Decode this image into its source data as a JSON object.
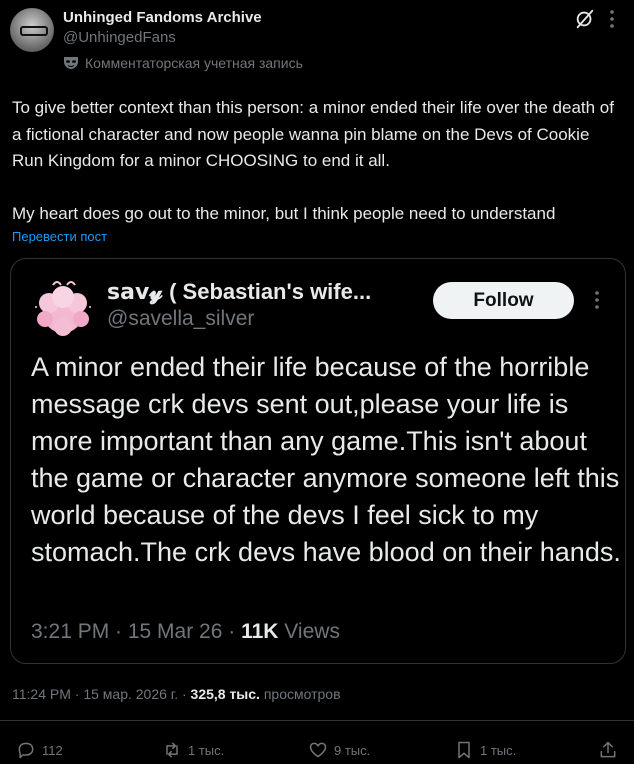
{
  "author": {
    "name": "Unhinged Fandoms Archive",
    "handle": "@UnhingedFans",
    "label": "Комментаторская учетная запись"
  },
  "tweet": {
    "paragraph1": "To give better context than this person: a minor ended their life over the death of a fictional character and now people wanna pin blame on the Devs of Cookie Run Kingdom for a minor CHOOSING to end it all.",
    "paragraph2": "My heart does go out to the minor, but I think people need to understand",
    "translate": "Перевести пост"
  },
  "quote": {
    "name": "𝘀𝗮𝘃𝔂 ( Sebastian's wife...",
    "handle": "@savella_silver",
    "follow": "Follow",
    "text": "A minor ended their life because of the horrible message crk devs sent out,please your life is more important than any game.This isn't about the game or character anymore someone left this world because of the devs I feel sick to my stomach.The crk devs have blood on their hands.",
    "time": "3:21 PM · 15 Mar 26 · ",
    "views_count": "11K",
    "views_label": " Views"
  },
  "meta": {
    "time": "11:24 PM · 15 мар. 2026 г. · ",
    "views_count": "325,8 тыс.",
    "views_label": " просмотров"
  },
  "actions": {
    "replies": "112",
    "reposts": "1 тыс.",
    "likes": "9 тыс.",
    "bookmarks": "1 тыс."
  },
  "colors": {
    "background": "#000000",
    "text": "#e7e9ea",
    "muted": "#71767b",
    "link": "#1d9bf0",
    "border": "#2f3336"
  }
}
